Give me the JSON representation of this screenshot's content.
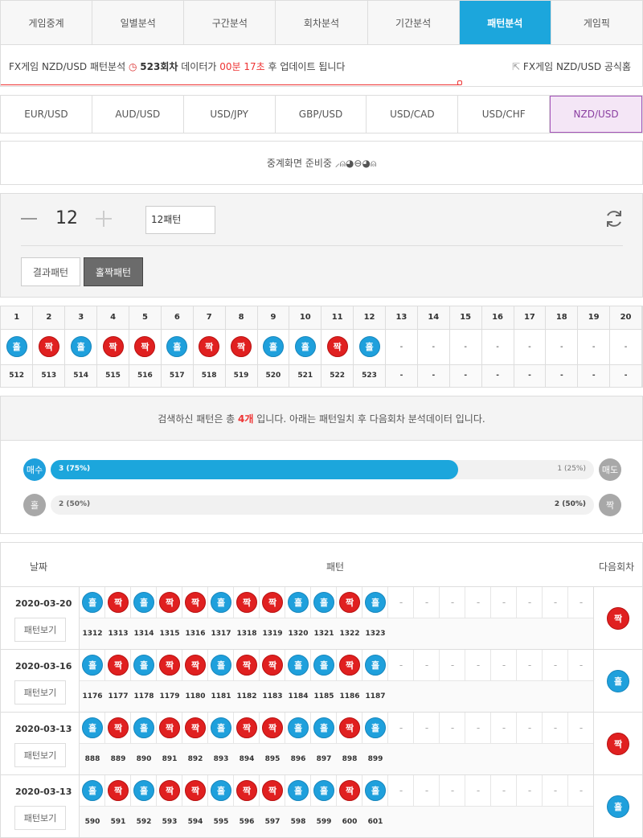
{
  "tabs": [
    "게임중계",
    "일별분석",
    "구간분석",
    "회차분석",
    "기간분석",
    "패턴분석",
    "게임픽"
  ],
  "active_tab": 5,
  "info": {
    "prefix": "FX게임 NZD/USD 패턴분석",
    "round": "523회차",
    "data_label": "데이터가",
    "time": "00분 17초",
    "suffix": "후 업데이트 됩니다",
    "official": "FX게임 NZD/USD 공식홈"
  },
  "pairs": [
    "EUR/USD",
    "AUD/USD",
    "USD/JPY",
    "GBP/USD",
    "USD/CAD",
    "USD/CHF",
    "NZD/USD"
  ],
  "active_pair": 6,
  "live_text": "중계화면 준비중 ⸝⍝◕⊖◕⍝",
  "controls": {
    "count": "12",
    "pattern_input": "12패턴",
    "btn_result": "결과패턴",
    "btn_oddeven": "홀짝패턴"
  },
  "grid": {
    "headers": [
      "1",
      "2",
      "3",
      "4",
      "5",
      "6",
      "7",
      "8",
      "9",
      "10",
      "11",
      "12",
      "13",
      "14",
      "15",
      "16",
      "17",
      "18",
      "19",
      "20"
    ],
    "balls": [
      "홀",
      "짝",
      "홀",
      "짝",
      "짝",
      "홀",
      "짝",
      "짝",
      "홀",
      "홀",
      "짝",
      "홀",
      "-",
      "-",
      "-",
      "-",
      "-",
      "-",
      "-",
      "-"
    ],
    "rounds": [
      "512",
      "513",
      "514",
      "515",
      "516",
      "517",
      "518",
      "519",
      "520",
      "521",
      "522",
      "523",
      "-",
      "-",
      "-",
      "-",
      "-",
      "-",
      "-",
      "-"
    ]
  },
  "summary": {
    "pre": "검색하신 패턴은 총",
    "count": "4개",
    "post": "입니다. 아래는 패턴일치 후 다음회차 분석데이터 입니다."
  },
  "stats": [
    {
      "left_label": "매수",
      "right_label": "매도",
      "left_text": "3 (75%)",
      "right_text": "1 (25%)",
      "fill_pct": 75
    },
    {
      "left_label": "홀",
      "right_label": "짝",
      "left_text": "2 (50%)",
      "right_text": "2 (50%)",
      "fill_pct": 0
    }
  ],
  "results": {
    "headers": {
      "date": "날짜",
      "pattern": "패턴",
      "next": "다음회차"
    },
    "view_label": "패턴보기",
    "rows": [
      {
        "date": "2020-03-20",
        "balls": [
          "홀",
          "짝",
          "홀",
          "짝",
          "짝",
          "홀",
          "짝",
          "짝",
          "홀",
          "홀",
          "짝",
          "홀"
        ],
        "rounds": [
          "1312",
          "1313",
          "1314",
          "1315",
          "1316",
          "1317",
          "1318",
          "1319",
          "1320",
          "1321",
          "1322",
          "1323"
        ],
        "next": "짝"
      },
      {
        "date": "2020-03-16",
        "balls": [
          "홀",
          "짝",
          "홀",
          "짝",
          "짝",
          "홀",
          "짝",
          "짝",
          "홀",
          "홀",
          "짝",
          "홀"
        ],
        "rounds": [
          "1176",
          "1177",
          "1178",
          "1179",
          "1180",
          "1181",
          "1182",
          "1183",
          "1184",
          "1185",
          "1186",
          "1187"
        ],
        "next": "홀"
      },
      {
        "date": "2020-03-13",
        "balls": [
          "홀",
          "짝",
          "홀",
          "짝",
          "짝",
          "홀",
          "짝",
          "짝",
          "홀",
          "홀",
          "짝",
          "홀"
        ],
        "rounds": [
          "888",
          "889",
          "890",
          "891",
          "892",
          "893",
          "894",
          "895",
          "896",
          "897",
          "898",
          "899"
        ],
        "next": "짝"
      },
      {
        "date": "2020-03-13",
        "balls": [
          "홀",
          "짝",
          "홀",
          "짝",
          "짝",
          "홀",
          "짝",
          "짝",
          "홀",
          "홀",
          "짝",
          "홀"
        ],
        "rounds": [
          "590",
          "591",
          "592",
          "593",
          "594",
          "595",
          "596",
          "597",
          "598",
          "599",
          "600",
          "601"
        ],
        "next": "홀"
      }
    ]
  },
  "colors": {
    "odd": "#1fa0dc",
    "even": "#e02020",
    "accent": "#1ca6dc",
    "active_pair": "#8a3fa1"
  }
}
